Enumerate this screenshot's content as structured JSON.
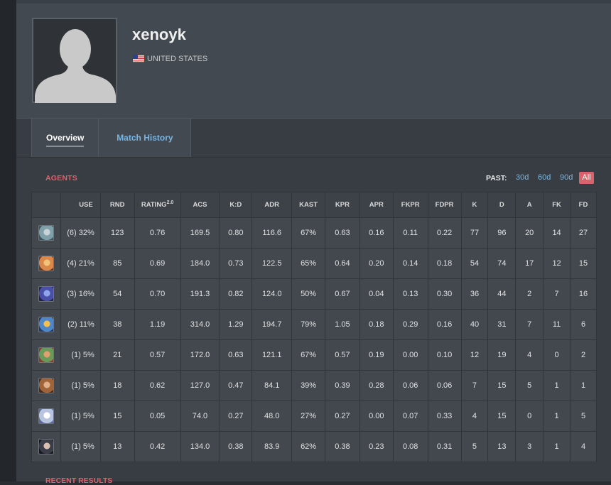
{
  "player": {
    "name": "xenoyk",
    "country": "UNITED STATES",
    "flag": "us-flag-icon"
  },
  "tabs": [
    {
      "label": "Overview",
      "active": true
    },
    {
      "label": "Match History",
      "active": false
    }
  ],
  "agents_section": {
    "title": "AGENTS",
    "past_label": "PAST:",
    "past_options": [
      "30d",
      "60d",
      "90d",
      "All"
    ],
    "past_selected": "All"
  },
  "table": {
    "headers": [
      "",
      "USE",
      "RND",
      "RATING",
      "ACS",
      "K:D",
      "ADR",
      "KAST",
      "KPR",
      "APR",
      "FKPR",
      "FDPR",
      "K",
      "D",
      "A",
      "FK",
      "FD"
    ],
    "rating_sup": "2.0",
    "rows": [
      {
        "colors": [
          "#7fa0a8",
          "#c9d3d6",
          "#3b5560"
        ],
        "cells": [
          "(6) 32%",
          "123",
          "0.76",
          "169.5",
          "0.80",
          "116.6",
          "67%",
          "0.63",
          "0.16",
          "0.11",
          "0.22",
          "77",
          "96",
          "20",
          "14",
          "27"
        ]
      },
      {
        "colors": [
          "#d9874a",
          "#f0c27a",
          "#6a3a22"
        ],
        "cells": [
          "(4) 21%",
          "85",
          "0.69",
          "184.0",
          "0.73",
          "122.5",
          "65%",
          "0.64",
          "0.20",
          "0.14",
          "0.18",
          "54",
          "74",
          "17",
          "12",
          "15"
        ]
      },
      {
        "colors": [
          "#4a4fa8",
          "#8fa6e8",
          "#20224a"
        ],
        "cells": [
          "(3) 16%",
          "54",
          "0.70",
          "191.3",
          "0.82",
          "124.0",
          "50%",
          "0.67",
          "0.04",
          "0.13",
          "0.30",
          "36",
          "44",
          "2",
          "7",
          "16"
        ]
      },
      {
        "colors": [
          "#4f86c9",
          "#f2c14e",
          "#1f3c66"
        ],
        "cells": [
          "(2) 11%",
          "38",
          "1.19",
          "314.0",
          "1.29",
          "194.7",
          "79%",
          "1.05",
          "0.18",
          "0.29",
          "0.16",
          "40",
          "31",
          "7",
          "11",
          "6"
        ]
      },
      {
        "colors": [
          "#6a9a5a",
          "#e0a070",
          "#8a3a2a"
        ],
        "cells": [
          "(1) 5%",
          "21",
          "0.57",
          "172.0",
          "0.63",
          "121.1",
          "67%",
          "0.57",
          "0.19",
          "0.00",
          "0.10",
          "12",
          "19",
          "4",
          "0",
          "2"
        ]
      },
      {
        "colors": [
          "#a0643a",
          "#e0b08a",
          "#4a2a18"
        ],
        "cells": [
          "(1) 5%",
          "18",
          "0.62",
          "127.0",
          "0.47",
          "84.1",
          "39%",
          "0.39",
          "0.28",
          "0.06",
          "0.06",
          "7",
          "15",
          "5",
          "1",
          "1"
        ]
      },
      {
        "colors": [
          "#b8c4e0",
          "#ffffff",
          "#5a6aa0"
        ],
        "cells": [
          "(1) 5%",
          "15",
          "0.05",
          "74.0",
          "0.27",
          "48.0",
          "27%",
          "0.27",
          "0.00",
          "0.07",
          "0.33",
          "4",
          "15",
          "0",
          "1",
          "5"
        ]
      },
      {
        "colors": [
          "#3a3d48",
          "#d8c0b0",
          "#15171c"
        ],
        "cells": [
          "(1) 5%",
          "13",
          "0.42",
          "134.0",
          "0.38",
          "83.9",
          "62%",
          "0.38",
          "0.23",
          "0.08",
          "0.31",
          "5",
          "13",
          "3",
          "1",
          "4"
        ]
      }
    ]
  },
  "recent_section": {
    "title": "RECENT RESULTS"
  }
}
